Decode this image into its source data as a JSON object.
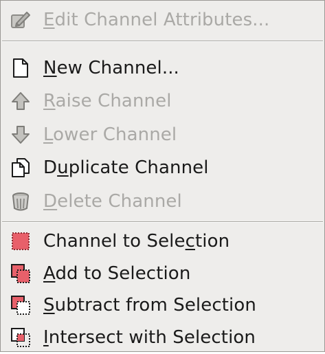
{
  "menu": {
    "items": [
      {
        "pre": "",
        "mn": "E",
        "post": "dit Channel Attributes...",
        "icon": "pencil-edit-icon",
        "enabled": false
      },
      {
        "pre": "",
        "mn": "N",
        "post": "ew Channel...",
        "icon": "new-page-icon",
        "enabled": true
      },
      {
        "pre": "",
        "mn": "R",
        "post": "aise Channel",
        "icon": "arrow-up-icon",
        "enabled": false
      },
      {
        "pre": "",
        "mn": "L",
        "post": "ower Channel",
        "icon": "arrow-down-icon",
        "enabled": false
      },
      {
        "pre": "D",
        "mn": "u",
        "post": "plicate Channel",
        "icon": "duplicate-icon",
        "enabled": true
      },
      {
        "pre": "",
        "mn": "D",
        "post": "elete Channel",
        "icon": "trash-icon",
        "enabled": false
      },
      {
        "pre": "Channel to Sele",
        "mn": "c",
        "post": "tion",
        "icon": "channel-to-selection-icon",
        "enabled": true
      },
      {
        "pre": "",
        "mn": "A",
        "post": "dd to Selection",
        "icon": "add-to-selection-icon",
        "enabled": true
      },
      {
        "pre": "",
        "mn": "S",
        "post": "ubtract from Selection",
        "icon": "subtract-from-selection-icon",
        "enabled": true
      },
      {
        "pre": "",
        "mn": "I",
        "post": "ntersect with Selection",
        "icon": "intersect-with-selection-icon",
        "enabled": true
      }
    ]
  },
  "colors": {
    "menu_bg": "#eeedeb",
    "text": "#1a1a1a",
    "disabled_text": "#aaa9a6",
    "selection_red": "#e8606a"
  }
}
